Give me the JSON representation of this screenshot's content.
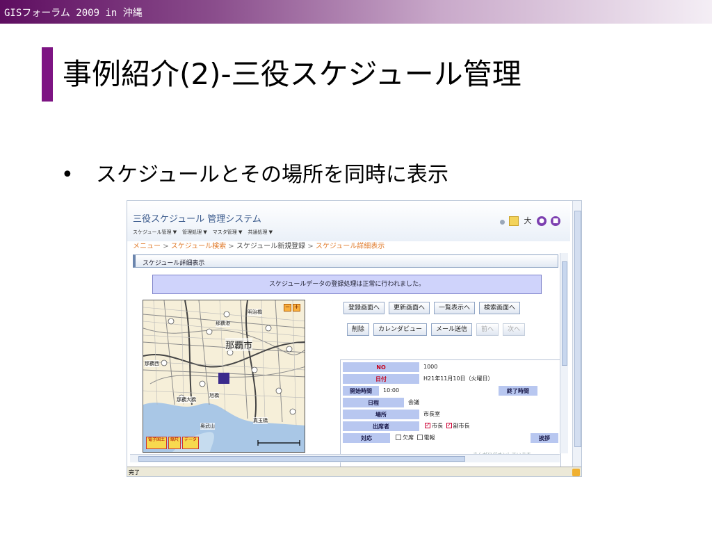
{
  "header": {
    "conference": "GISフォーラム 2009 in 沖縄"
  },
  "slide": {
    "title": "事例紹介(2)-三役スケジュール管理",
    "bullet_symbol": "•",
    "bullet_text": "スケジュールとその場所を同時に表示"
  },
  "app": {
    "title": "三役スケジュール 管理システム",
    "header_icons": [
      "dot-icon",
      "yellow-square-icon",
      "text-size-icon",
      "help-icon",
      "logout-icon"
    ],
    "text_size_glyph": "大",
    "menu": [
      "スケジュール管理 ▼",
      "管理処理 ▼",
      "マスタ管理 ▼",
      "共通処理 ▼"
    ],
    "breadcrumb": {
      "menu": "メニュー",
      "search": "スケジュール検索",
      "register": "スケジュール新規登録",
      "current": "スケジュール詳細表示",
      "separator": ">"
    },
    "section_title": "スケジュール詳細表示",
    "notice": "スケジュールデータの登録処理は正常に行われました。",
    "nav_buttons": [
      "登録画面へ",
      "更新画面へ",
      "一覧表示へ",
      "検索画面へ"
    ],
    "action_buttons": [
      "削除",
      "カレンダビュー",
      "メール送信",
      "前へ",
      "次へ"
    ],
    "map": {
      "city_label": "那覇市",
      "zoom_out": "−",
      "zoom_in": "+",
      "labels": [
        "那覇港",
        "明治橋",
        "那覇西",
        "旭橋",
        "奥武山",
        "那覇大橋",
        "真玉橋"
      ],
      "tool_buttons": [
        "電子国土",
        "縮尺",
        "データ"
      ]
    },
    "detail": {
      "no_label": "NO",
      "no_value": "1000",
      "date_label": "日付",
      "date_value": "H21年11月10日（火曜日）",
      "start_label": "開始時間",
      "start_value": "10:00",
      "end_label": "終了時間",
      "agenda_label": "日程",
      "agenda_value": "会議",
      "place_label": "場所",
      "place_value": "市長室",
      "attendees_label": "出席者",
      "attendee_1": "市長",
      "attendee_2": "副市長",
      "response_label": "対応",
      "response_1": "欠席",
      "response_2": "電報",
      "greeting_label": "挨拶"
    },
    "footer_partial": "さんがログオンしています",
    "status_text": "完了"
  }
}
